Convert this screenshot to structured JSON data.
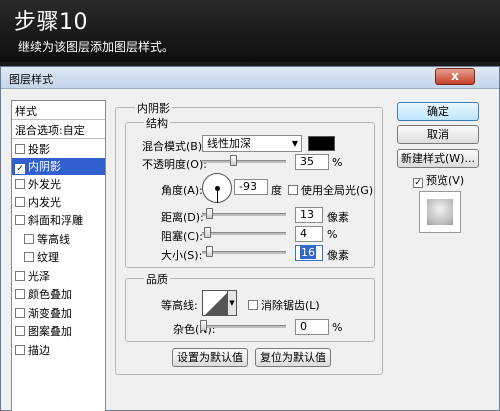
{
  "banner": {
    "step_title": "步骤10",
    "description": "继续为该图层添加图层样式。"
  },
  "dialog": {
    "title": "图层样式",
    "close_label": "x"
  },
  "style_list": {
    "header": "样式",
    "blend_options": "混合选项:自定",
    "items": [
      {
        "label": "投影",
        "checked": false
      },
      {
        "label": "内阴影",
        "checked": true,
        "selected": true
      },
      {
        "label": "外发光",
        "checked": false
      },
      {
        "label": "内发光",
        "checked": false
      },
      {
        "label": "斜面和浮雕",
        "checked": false
      },
      {
        "label": "等高线",
        "checked": false,
        "indent": true
      },
      {
        "label": "纹理",
        "checked": false,
        "indent": true
      },
      {
        "label": "光泽",
        "checked": false
      },
      {
        "label": "颜色叠加",
        "checked": false
      },
      {
        "label": "渐变叠加",
        "checked": false
      },
      {
        "label": "图案叠加",
        "checked": false
      },
      {
        "label": "描边",
        "checked": false
      }
    ]
  },
  "inner_shadow": {
    "section_title": "内阴影",
    "structure_title": "结构",
    "blend_mode_label": "混合模式(B):",
    "blend_mode_value": "线性加深",
    "shadow_color": "#000000",
    "opacity_label": "不透明度(O):",
    "opacity_value": "35",
    "opacity_unit": "%",
    "angle_label": "角度(A):",
    "angle_value": "-93",
    "angle_unit": "度",
    "global_light_label": "使用全局光(G)",
    "distance_label": "距离(D):",
    "distance_value": "13",
    "distance_unit": "像素",
    "choke_label": "阻塞(C):",
    "choke_value": "4",
    "choke_unit": "%",
    "size_label": "大小(S):",
    "size_value": "16",
    "size_unit": "像素",
    "quality_title": "品质",
    "contour_label": "等高线:",
    "anti_alias_label": "消除锯齿(L)",
    "noise_label": "杂色(N):",
    "noise_value": "0",
    "noise_unit": "%",
    "set_default_label": "设置为默认值",
    "reset_default_label": "复位为默认值"
  },
  "side_buttons": {
    "ok_label": "确定",
    "cancel_label": "取消",
    "new_style_label": "新建样式(W)...",
    "preview_label": "预览(V)"
  }
}
